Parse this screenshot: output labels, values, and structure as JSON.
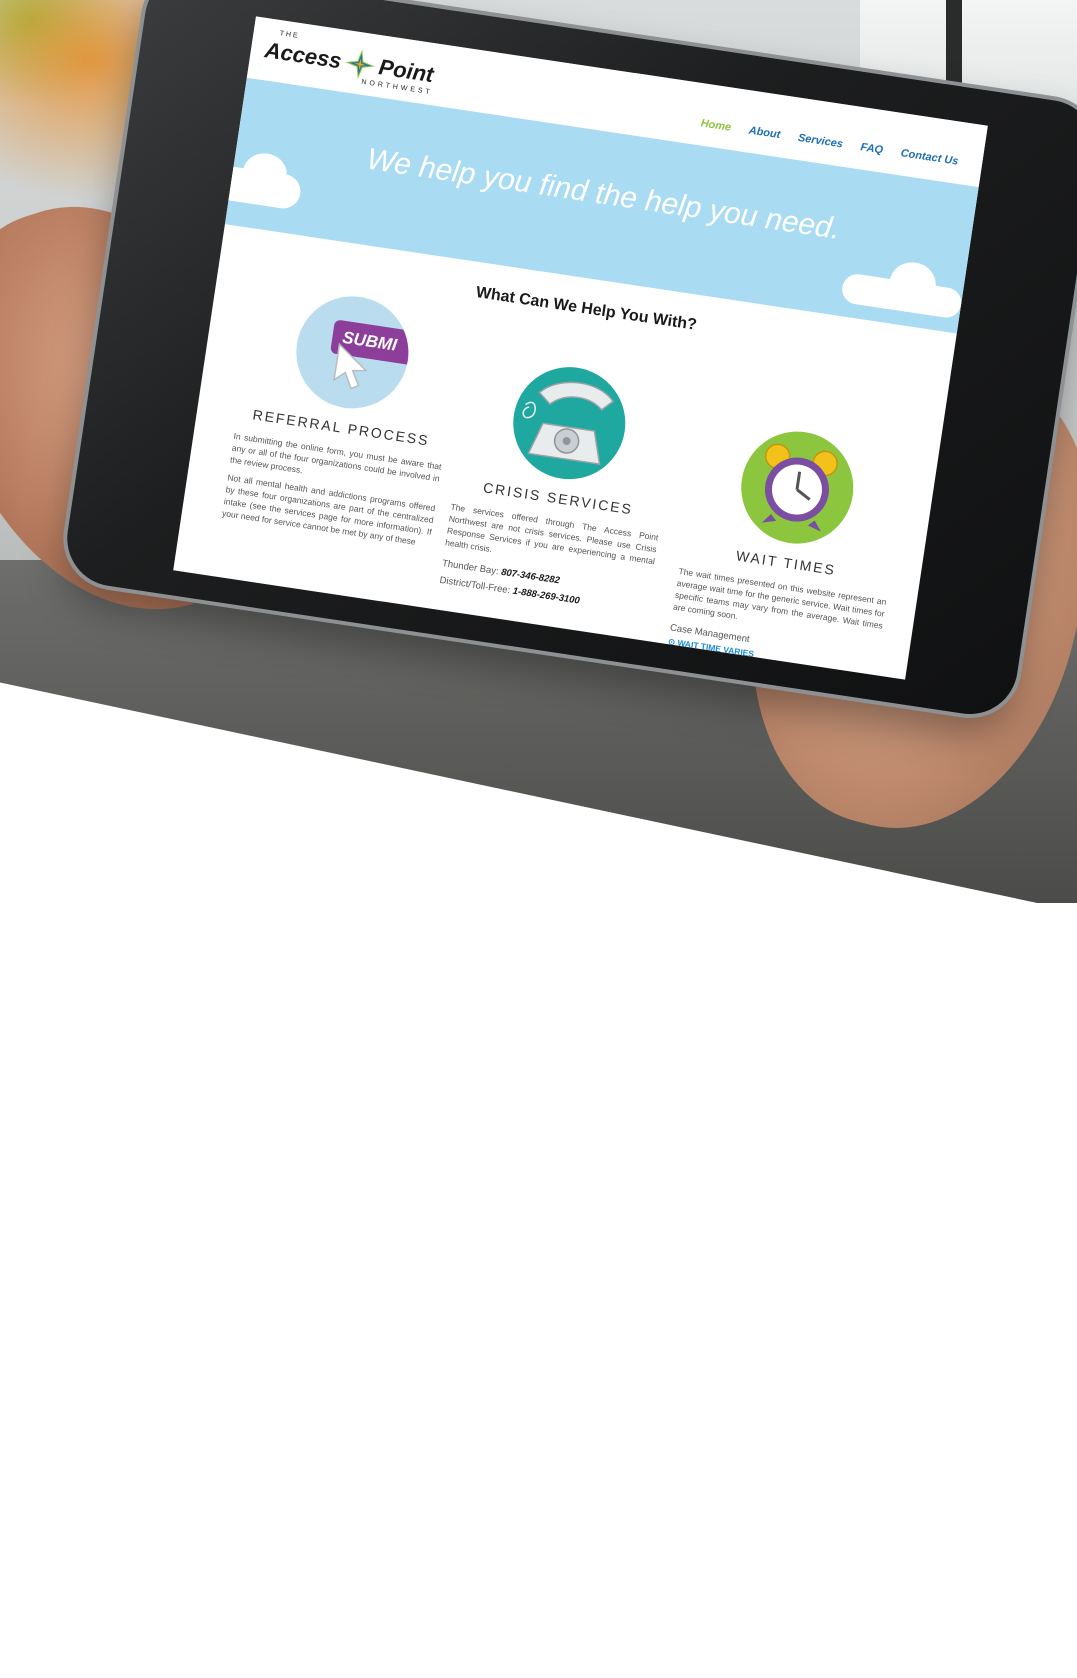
{
  "site": {
    "logo": {
      "the": "THE",
      "access": "Access",
      "point": "Point",
      "northwest": "NORTHWEST"
    },
    "nav": [
      "Home",
      "About",
      "Services",
      "FAQ",
      "Contact Us"
    ],
    "nav_active": "Home",
    "hero_text": "We help you find the help you need.",
    "section_title": "What Can We Help You With?"
  },
  "columns": [
    {
      "title": "REFERRAL PROCESS",
      "icon_text": "SUBMI",
      "paragraphs": [
        "In submitting the online form, you must be aware that any or all of the four organizations could be involved in the review process.",
        "Not all mental health and addictions programs offered by these four organizations are part of the centralized intake (see the services page for more information). If your need for service cannot be met by any of these"
      ]
    },
    {
      "title": "CRISIS SERVICES",
      "paragraphs": [
        "The services offered through The Access Point Northwest are not crisis services. Please use Crisis Response Services if you are experiencing a mental health crisis."
      ],
      "phones": [
        {
          "label": "Thunder Bay:",
          "number": "807-346-8282"
        },
        {
          "label": "District/Toll-Free:",
          "number": "1-888-269-3100"
        }
      ]
    },
    {
      "title": "WAIT TIMES",
      "paragraphs": [
        "The wait times presented on this website represent an average wait time for the generic service. Wait times for specific teams may vary from the average. Wait times are coming soon."
      ],
      "service": "Case Management",
      "wait_label": "WAIT TIME VARIES"
    }
  ],
  "colors": {
    "hero": "#a9dcf3",
    "nav_link": "#1d6fb8",
    "nav_active": "#8cc63f",
    "wait_link": "#1d8cd4"
  }
}
